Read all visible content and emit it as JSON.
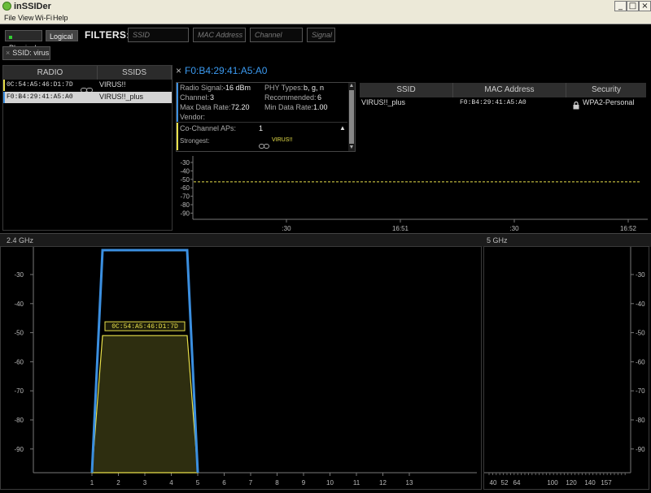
{
  "window": {
    "title": "inSSIDer",
    "controls": [
      "_",
      "□",
      "×"
    ]
  },
  "menu": [
    "File",
    "View",
    "Wi-Fi",
    "Help"
  ],
  "view_toggle": {
    "physical": "Physical",
    "logical": "Logical",
    "selected": "Logical"
  },
  "filters": {
    "label": "FILTERS:",
    "ssid_placeholder": "SSID",
    "mac_placeholder": "MAC Address",
    "channel_placeholder": "Channel",
    "signal_placeholder": "Signal"
  },
  "active_filter": {
    "close": "×",
    "label": "SSID: virus"
  },
  "radio_table": {
    "headers": [
      "RADIO",
      "SSIDS"
    ],
    "rows": [
      {
        "radio": "0C:54:A5:46:D1:7D",
        "ssid": "VIRUS!!",
        "color": "#e8e04a",
        "selected": false
      },
      {
        "radio": "F0:B4:29:41:A5:A0",
        "ssid": "VIRUS!!_plus",
        "color": "#3b8fe0",
        "selected": true
      }
    ]
  },
  "detail": {
    "close": "×",
    "mac": "F0:B4:29:41:A5:A0",
    "radio_signal_label": "Radio Signal:",
    "radio_signal_value": "-16 dBm",
    "channel_label": "Channel:",
    "channel_value": "3",
    "max_rate_label": "Max Data Rate:",
    "max_rate_value": "72.20",
    "vendor_label": "Vendor:",
    "phy_label": "PHY Types:",
    "phy_value": "b, g, n",
    "recommended_label": "Recommended:",
    "recommended_value": "6",
    "min_rate_label": "Min Data Rate:",
    "min_rate_value": "1.00",
    "cochannel_label": "Co-Channel APs:",
    "cochannel_value": "1",
    "strongest_label": "Strongest:",
    "strongest_value": "VIRUS!!"
  },
  "ssid_table": {
    "headers": [
      "SSID",
      "MAC Address",
      "Security"
    ],
    "row": {
      "ssid": "VIRUS!!_plus",
      "mac": "F0:B4:29:41:A5:A0",
      "security": "WPA2-Personal"
    }
  },
  "time_graph": {
    "y_ticks": [
      "-30",
      "-40",
      "-50",
      "-60",
      "-70",
      "-80",
      "-90"
    ],
    "x_ticks": [
      ":30",
      "16:51",
      ":30",
      "16:52"
    ],
    "signal_dbm": -53,
    "line_color": "#e8e04a"
  },
  "band_24": {
    "label": "2.4 GHz",
    "y_ticks": [
      "-30",
      "-40",
      "-50",
      "-60",
      "-70",
      "-80",
      "-90"
    ],
    "x_ticks": [
      "1",
      "2",
      "3",
      "4",
      "5",
      "6",
      "7",
      "8",
      "9",
      "10",
      "11",
      "12",
      "13"
    ],
    "networks": [
      {
        "label": "F0:B4:29:41:A5:A0",
        "channel": 3,
        "signal_dbm": -16,
        "color": "#3b8fe0"
      },
      {
        "label": "0C:54:A5:46:D1:7D",
        "channel": 3,
        "signal_dbm": -51,
        "color": "#e8e04a"
      }
    ]
  },
  "band_5": {
    "label": "5 GHz",
    "y_ticks": [
      "-30",
      "-40",
      "-50",
      "-60",
      "-70",
      "-80",
      "-90"
    ],
    "x_ticks": [
      "40",
      "52",
      "64",
      "100",
      "120",
      "140",
      "157"
    ]
  }
}
